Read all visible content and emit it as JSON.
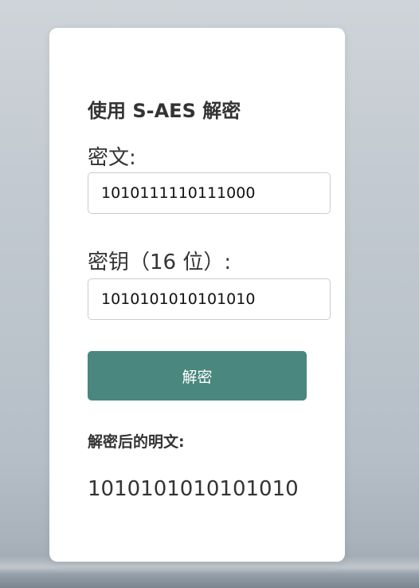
{
  "form": {
    "title": "使用 S-AES 解密",
    "ciphertext_label": "密文:",
    "ciphertext_value": "1010111110111000",
    "key_label": "密钥（16 位）:",
    "key_value": "1010101010101010",
    "decrypt_button_label": "解密",
    "result_label": "解密后的明文:",
    "result_value": "1010101010101010"
  },
  "colors": {
    "button": "#4a877e",
    "card": "#ffffff",
    "text": "#333333"
  }
}
